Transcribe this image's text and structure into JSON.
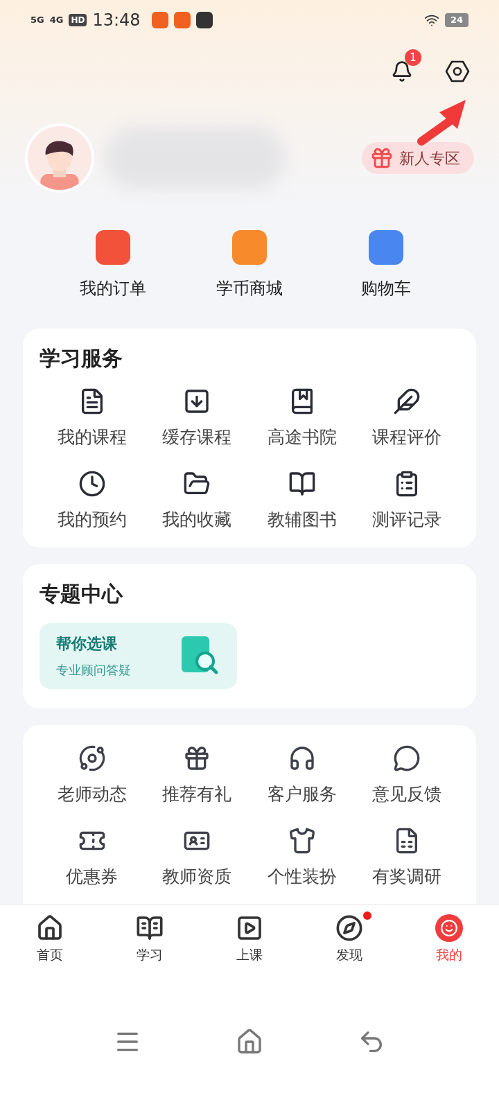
{
  "status_bar": {
    "signal_1": "5G",
    "signal_2": "4G",
    "hd": "HD",
    "time": "13:48",
    "battery": "24"
  },
  "header": {
    "notification_count": "1"
  },
  "profile": {
    "promo": "新人专区"
  },
  "quick_links": [
    {
      "label": "我的订单"
    },
    {
      "label": "学币商城"
    },
    {
      "label": "购物车"
    }
  ],
  "study_services": {
    "title": "学习服务",
    "items": [
      {
        "label": "我的课程"
      },
      {
        "label": "缓存课程"
      },
      {
        "label": "高途书院"
      },
      {
        "label": "课程评价"
      },
      {
        "label": "我的预约"
      },
      {
        "label": "我的收藏"
      },
      {
        "label": "教辅图书"
      },
      {
        "label": "测评记录"
      }
    ]
  },
  "topic_center": {
    "title": "专题中心",
    "card": {
      "title": "帮你选课",
      "subtitle": "专业顾问答疑"
    }
  },
  "more_services": {
    "items": [
      {
        "label": "老师动态"
      },
      {
        "label": "推荐有礼"
      },
      {
        "label": "客户服务"
      },
      {
        "label": "意见反馈"
      },
      {
        "label": "优惠券"
      },
      {
        "label": "教师资质"
      },
      {
        "label": "个性装扮"
      },
      {
        "label": "有奖调研"
      }
    ]
  },
  "tab_bar": [
    {
      "label": "首页",
      "selected": false,
      "dot": false
    },
    {
      "label": "学习",
      "selected": false,
      "dot": false
    },
    {
      "label": "上课",
      "selected": false,
      "dot": false
    },
    {
      "label": "发现",
      "selected": false,
      "dot": true
    },
    {
      "label": "我的",
      "selected": true,
      "dot": false
    }
  ]
}
